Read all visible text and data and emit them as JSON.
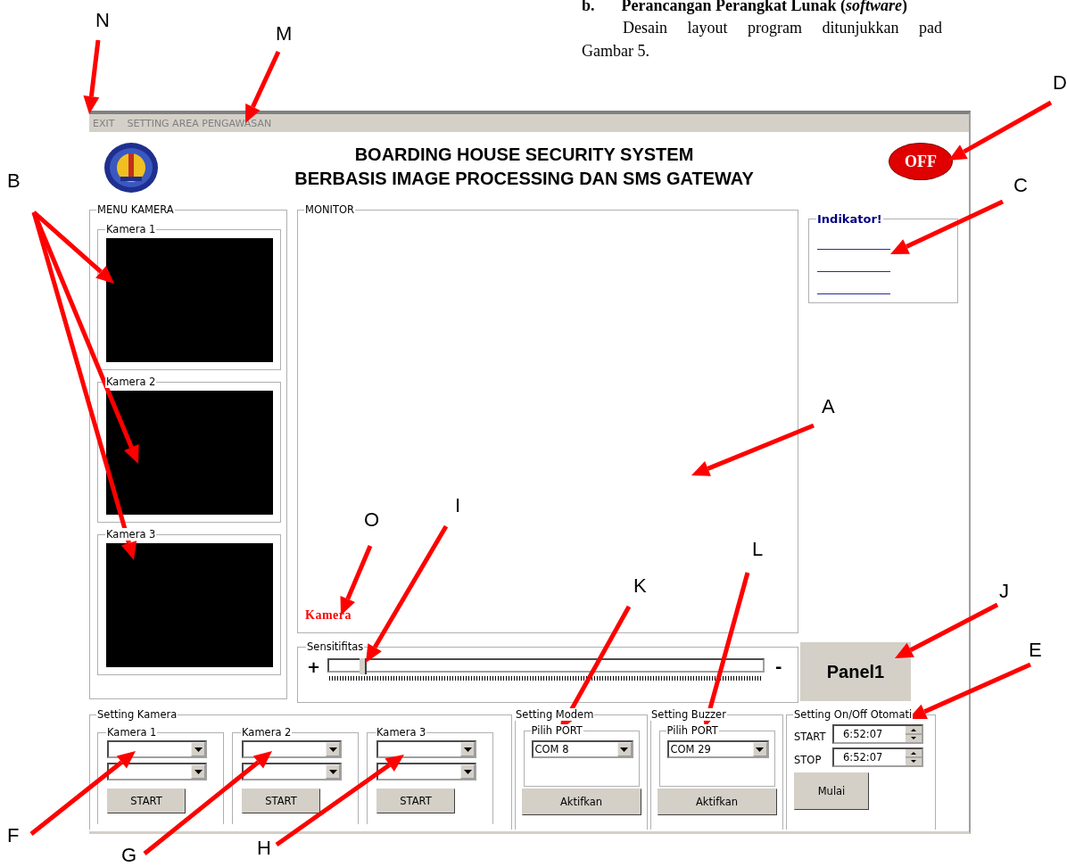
{
  "document": {
    "heading_marker": "b.",
    "heading": "Perancangan Perangkat Lunak (*software*)",
    "line_1": "Desain layout program ditunjukkan pad",
    "line_2": "Gambar 5."
  },
  "window": {
    "menu": [
      "EXIT",
      "SETTING AREA PENGAWASAN"
    ],
    "title_lines": [
      "BOARDING HOUSE SECURITY SYSTEM",
      "BERBASIS IMAGE PROCESSING DAN SMS GATEWAY"
    ],
    "power_badge": "OFF",
    "menu_kamera": {
      "title": "MENU KAMERA",
      "cameras": [
        "Kamera 1",
        "Kamera 2",
        "Kamera 3"
      ]
    },
    "monitor": {
      "title": "MONITOR",
      "camera_label": "Kamera"
    },
    "sensitivity": {
      "title": "Sensitifitas",
      "plus": "+",
      "minus": "-",
      "level": 0.07
    },
    "indicator": {
      "title": "Indikator!"
    },
    "panel_button": "Panel1",
    "setting_kamera": {
      "title": "Setting Kamera",
      "groups": [
        {
          "title": "Kamera 1",
          "button": "START"
        },
        {
          "title": "Kamera 2",
          "button": "START"
        },
        {
          "title": "Kamera 3",
          "button": "START"
        }
      ]
    },
    "port_settings": [
      {
        "title": "Setting Modem",
        "group": "Pilih PORT",
        "port": "COM 8",
        "button": "Aktifkan"
      },
      {
        "title": "Setting Buzzer",
        "group": "Pilih PORT",
        "port": "COM 29",
        "button": "Aktifkan"
      }
    ],
    "schedule": {
      "title": "Setting On/Off Otomati",
      "rows": [
        {
          "label": "START",
          "value": "6:52:07"
        },
        {
          "label": "STOP",
          "value": "6:52:07"
        }
      ],
      "button": "Mulai"
    }
  },
  "annotations": [
    "N",
    "M",
    "D",
    "B",
    "C",
    "A",
    "I",
    "O",
    "K",
    "L",
    "J",
    "E",
    "F",
    "G",
    "H"
  ]
}
